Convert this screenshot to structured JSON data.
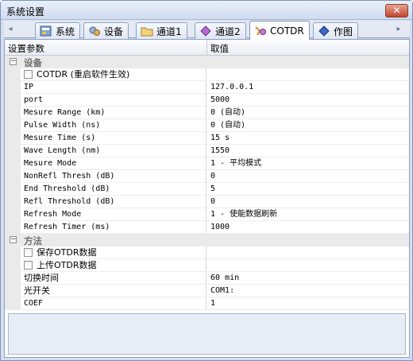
{
  "window": {
    "title": "系统设置",
    "close_glyph": "✕"
  },
  "tabs": [
    {
      "label": "系统",
      "icon": "system-settings-icon",
      "active": false
    },
    {
      "label": "设备",
      "icon": "device-gear-icon",
      "active": false
    },
    {
      "label": "通道1",
      "icon": "folder-icon",
      "active": false
    },
    {
      "label": "通道2",
      "icon": "purple-diamond-icon",
      "active": false
    },
    {
      "label": "COTDR",
      "icon": "cotdr-tool-icon",
      "active": true
    },
    {
      "label": "作图",
      "icon": "blue-diamond-icon",
      "active": false
    }
  ],
  "grid": {
    "header": {
      "name": "设置参数",
      "value": "取值"
    },
    "categories": [
      {
        "label": "设备",
        "toggle": "−",
        "rows": [
          {
            "name": "COTDR (重启软件生效)",
            "value": "",
            "checkbox": true
          },
          {
            "name": "IP",
            "value": "127.0.0.1"
          },
          {
            "name": "port",
            "value": "5000"
          },
          {
            "name": "Mesure Range (km)",
            "value": "0 (自动)"
          },
          {
            "name": "Pulse Width (ns)",
            "value": "0 (自动)"
          },
          {
            "name": "Mesure Time (s)",
            "value": "15 s"
          },
          {
            "name": "Wave Length (nm)",
            "value": "1550"
          },
          {
            "name": "Mesure Mode",
            "value": "1 - 平均模式"
          },
          {
            "name": "NonRefl Thresh (dB)",
            "value": "0"
          },
          {
            "name": "End Threshold (dB)",
            "value": "5"
          },
          {
            "name": "Refl Threshold (dB)",
            "value": "0"
          },
          {
            "name": "Refresh Mode",
            "value": "1 - 使能数据刷新"
          },
          {
            "name": "Refresh Timer (ms)",
            "value": "1000"
          }
        ]
      },
      {
        "label": "方法",
        "toggle": "−",
        "rows": [
          {
            "name": "保存OTDR数据",
            "value": "",
            "checkbox": true
          },
          {
            "name": "上传OTDR数据",
            "value": "",
            "checkbox": true
          },
          {
            "name": "切换时间",
            "value": "60 min"
          },
          {
            "name": "光开关",
            "value": "COM1:"
          },
          {
            "name": "COEF",
            "value": "1"
          }
        ]
      }
    ]
  },
  "scroll": {
    "left": "◂",
    "right": "▸"
  }
}
